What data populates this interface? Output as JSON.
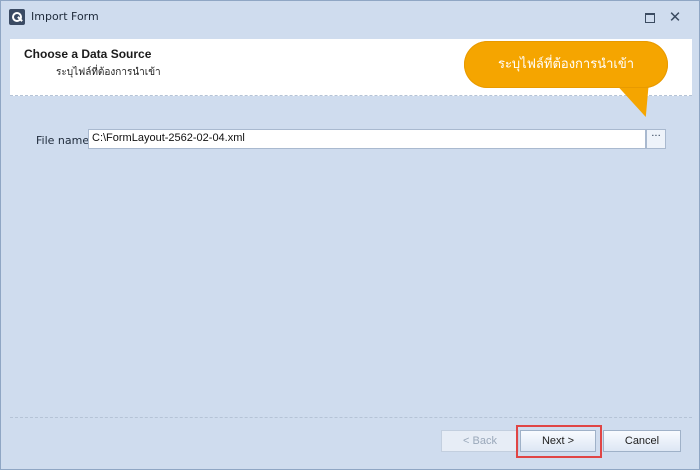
{
  "window": {
    "title": "Import Form"
  },
  "header": {
    "title": "Choose a Data Source",
    "subtitle": "ระบุไฟล์ที่ต้องการนำเข้า"
  },
  "callout": {
    "text": "ระบุไฟล์ที่ต้องการนำเข้า"
  },
  "form": {
    "file_label": "File name",
    "file_value": "C:\\FormLayout-2562-02-04.xml",
    "browse_label": "···"
  },
  "buttons": {
    "back": "< Back",
    "next": "Next >",
    "cancel": "Cancel"
  },
  "colors": {
    "callout": "#f5a500",
    "highlight": "#e04545",
    "window_bg": "#cfdcee"
  }
}
